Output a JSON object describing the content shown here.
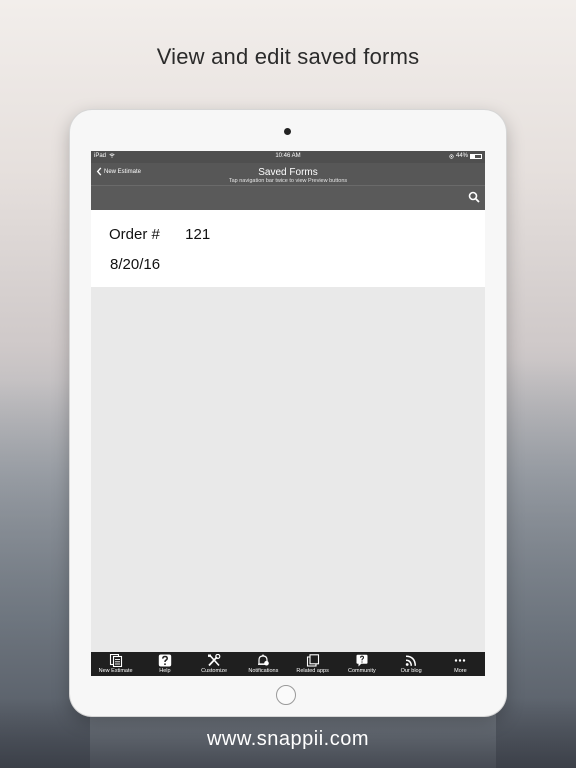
{
  "headline": "View and edit saved forms",
  "footer_url": "www.snappii.com",
  "status_bar": {
    "carrier": "iPad",
    "time": "10:46 AM",
    "battery": "44%",
    "battery_level": 0.44
  },
  "navbar": {
    "back_label": "New Estimate",
    "title": "Saved Forms",
    "subtitle": "Tap navigation bar twice to view Preview buttons"
  },
  "search": {
    "icon": "search-icon"
  },
  "saved_forms": [
    {
      "label": "Order #",
      "order_number": "121",
      "date": "8/20/16"
    }
  ],
  "tabs": [
    {
      "label": "New Estimate",
      "icon": "new-estimate-icon"
    },
    {
      "label": "Help",
      "icon": "help-icon"
    },
    {
      "label": "Customize",
      "icon": "customize-icon"
    },
    {
      "label": "Notifications",
      "icon": "notifications-icon"
    },
    {
      "label": "Related apps",
      "icon": "related-apps-icon"
    },
    {
      "label": "Community",
      "icon": "community-icon"
    },
    {
      "label": "Our blog",
      "icon": "blog-icon"
    },
    {
      "label": "More",
      "icon": "more-icon"
    }
  ]
}
